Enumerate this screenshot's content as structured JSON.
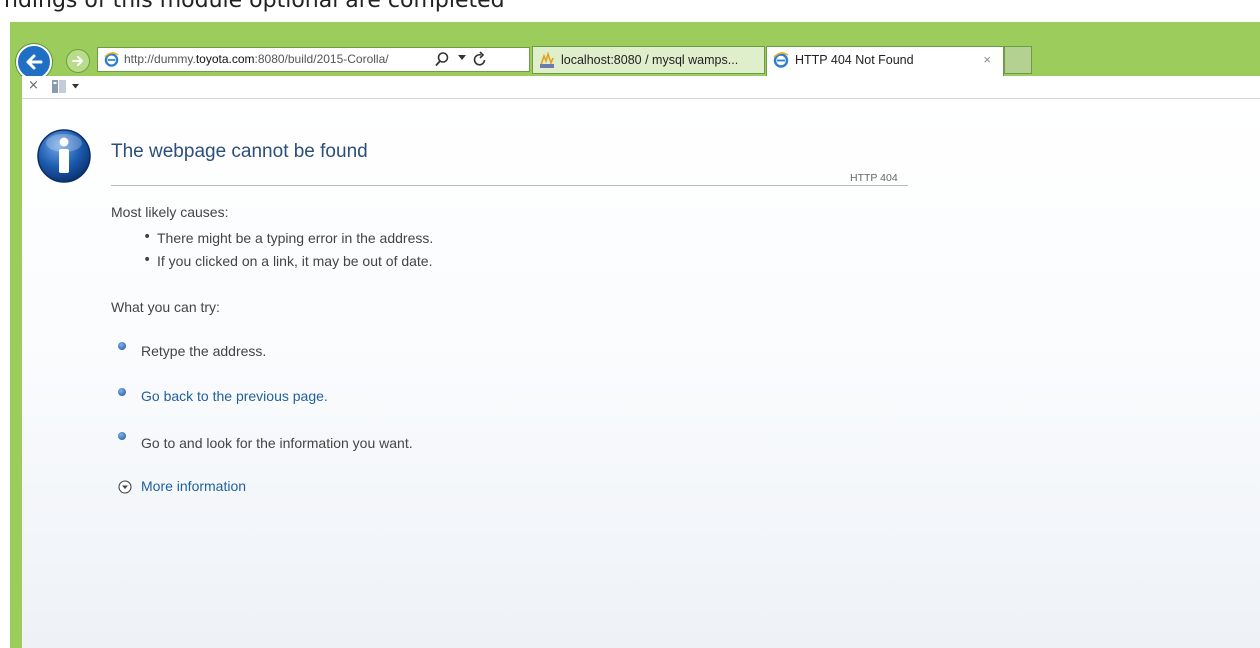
{
  "caption": {
    "text": "ndings of this module optional are completed"
  },
  "browser": {
    "address_prefix": "http://dummy.",
    "address_domain": "toyota.com",
    "address_suffix": ":8080/build/2015-Corolla/",
    "tabs": [
      {
        "label": "localhost:8080 / mysql wamps...",
        "icon": "phpmyadmin-icon",
        "active": false
      },
      {
        "label": "HTTP 404 Not Found",
        "icon": "ie-icon",
        "active": true,
        "close": "×"
      }
    ]
  },
  "subbar": {
    "close_glyph": "×"
  },
  "error_page": {
    "title": "The webpage cannot be found",
    "code": "HTTP 404",
    "causes_heading": "Most likely causes:",
    "causes": [
      "There might be a typing error in the address.",
      "If you clicked on a link, it may be out of date."
    ],
    "try_heading": "What you can try:",
    "suggestions": [
      {
        "text": "Retype the address.",
        "link": false
      },
      {
        "text": "Go back to the previous page.",
        "link": true
      },
      {
        "text": "Go to  and look for the information you want.",
        "link": false
      }
    ],
    "more_info": "More information"
  },
  "colors": {
    "frame": "#9ccc5c",
    "title": "#2b4f7a",
    "link": "#1f5f9c"
  }
}
